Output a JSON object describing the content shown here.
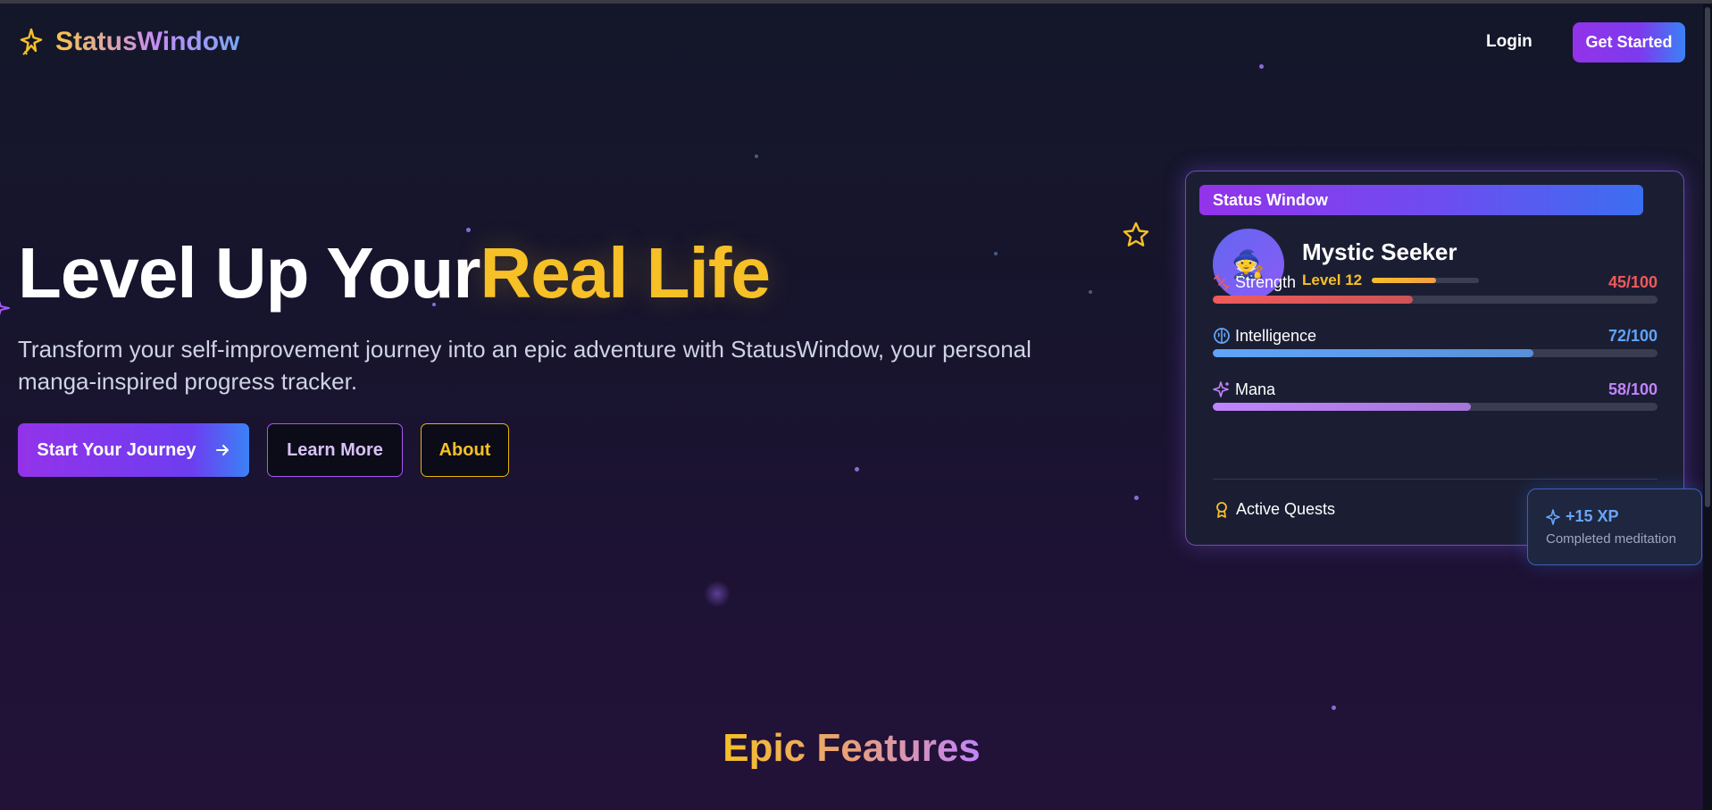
{
  "header": {
    "logo_text": "StatusWindow",
    "login_label": "Login",
    "get_started_label": "Get Started"
  },
  "hero": {
    "title_part1": "Level Up Your",
    "title_part2": "Real Life",
    "subtitle": "Transform your self-improvement journey into an epic adventure with StatusWindow, your personal manga-inspired progress tracker.",
    "buttons": {
      "start": "Start Your Journey",
      "learn": "Learn More",
      "about": "About"
    }
  },
  "status_card": {
    "tab_label": "Status Window",
    "avatar_emoji": "🧙",
    "character_name": "Mystic Seeker",
    "level_label": "Level 12",
    "level_progress": 0.6,
    "stats": [
      {
        "label": "Strength",
        "value_text": "45/100",
        "value": 45,
        "max": 100,
        "color": "#f05a5a",
        "icon": "dumbbell-icon"
      },
      {
        "label": "Intelligence",
        "value_text": "72/100",
        "value": 72,
        "max": 100,
        "color": "#60a5fa",
        "icon": "brain-icon"
      },
      {
        "label": "Mana",
        "value_text": "58/100",
        "value": 58,
        "max": 100,
        "color": "#c084fc",
        "icon": "sparkles-icon"
      }
    ],
    "quests_label": "Active Quests"
  },
  "xp_toast": {
    "title": "+15 XP",
    "subtitle": "Completed meditation"
  },
  "features": {
    "heading": "Epic Features"
  },
  "colors": {
    "accent_purple": "#9333ea",
    "accent_blue": "#3b82f6",
    "accent_gold": "#f6c026"
  }
}
